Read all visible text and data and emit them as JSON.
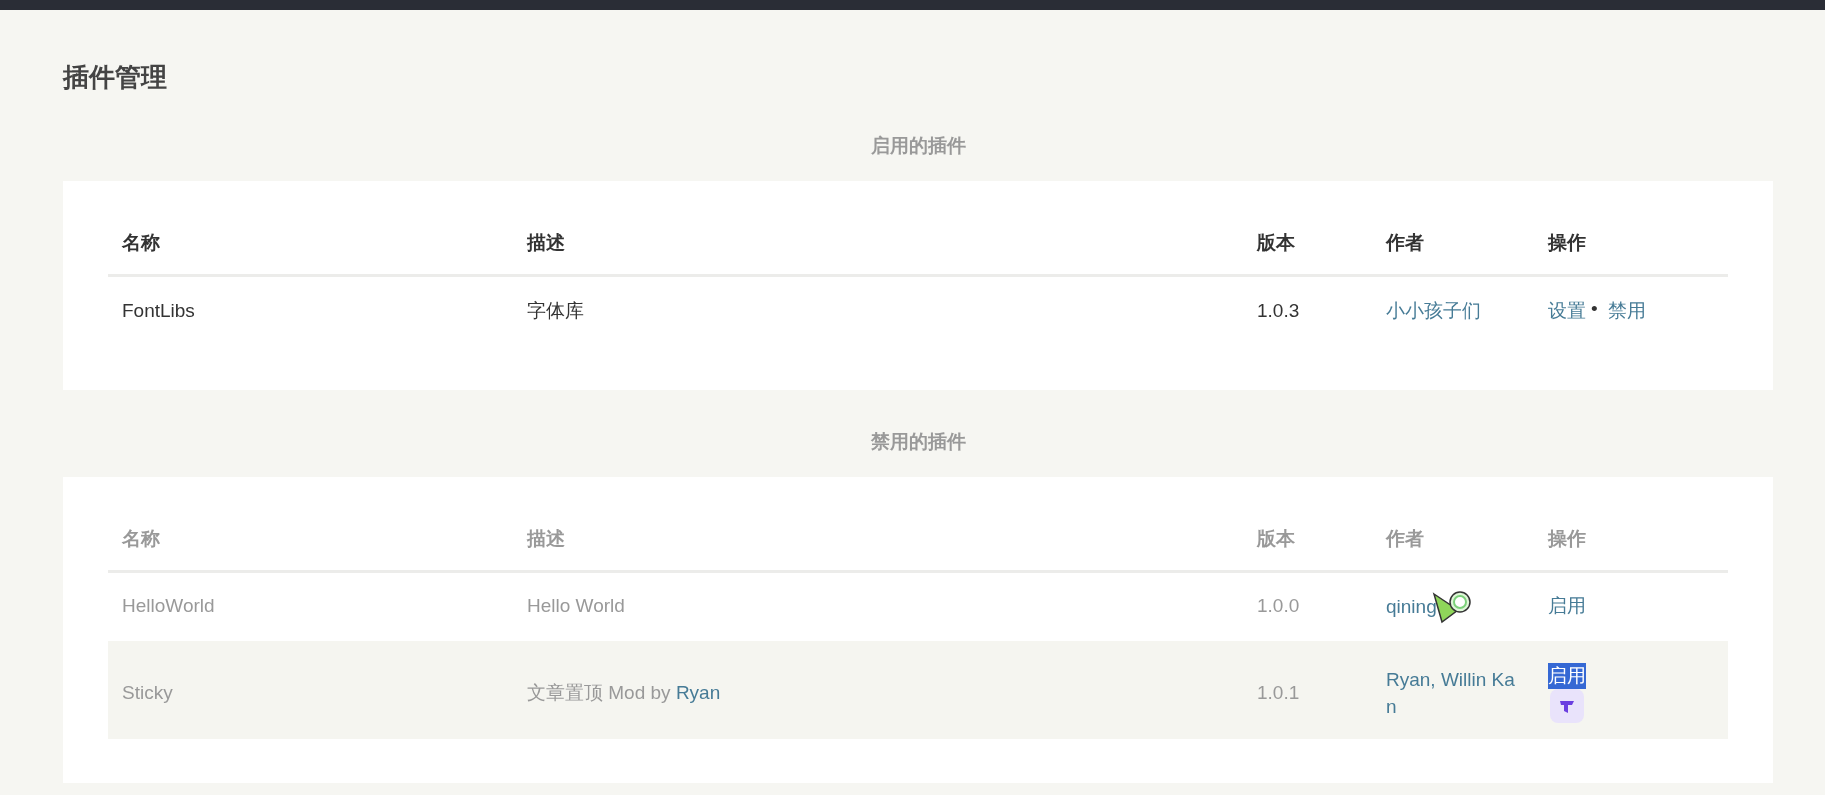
{
  "page_title": "插件管理",
  "sections": [
    {
      "heading": "启用的插件",
      "disabled": false,
      "columns": [
        "名称",
        "描述",
        "版本",
        "作者",
        "操作"
      ],
      "rows": [
        {
          "name": "FontLibs",
          "description": [
            {
              "kind": "text",
              "text": "字体库"
            }
          ],
          "version": "1.0.3",
          "author": "小小孩子们",
          "actions": [
            {
              "label": "设置",
              "highlighted": false
            },
            {
              "label": "禁用",
              "highlighted": false
            }
          ],
          "separator": "•",
          "striped": false
        }
      ]
    },
    {
      "heading": "禁用的插件",
      "disabled": true,
      "columns": [
        "名称",
        "描述",
        "版本",
        "作者",
        "操作"
      ],
      "rows": [
        {
          "name": "HelloWorld",
          "description": [
            {
              "kind": "text",
              "text": "Hello World"
            }
          ],
          "version": "1.0.0",
          "author": "qining",
          "actions": [
            {
              "label": "启用",
              "highlighted": false
            }
          ],
          "striped": false
        },
        {
          "name": "Sticky",
          "description": [
            {
              "kind": "text",
              "text": "文章置顶 Mod by "
            },
            {
              "kind": "link",
              "text": "Ryan"
            }
          ],
          "version": "1.0.1",
          "author": "Ryan, Willin Kan",
          "actions": [
            {
              "label": "启用",
              "highlighted": true
            }
          ],
          "striped": true
        }
      ]
    }
  ]
}
